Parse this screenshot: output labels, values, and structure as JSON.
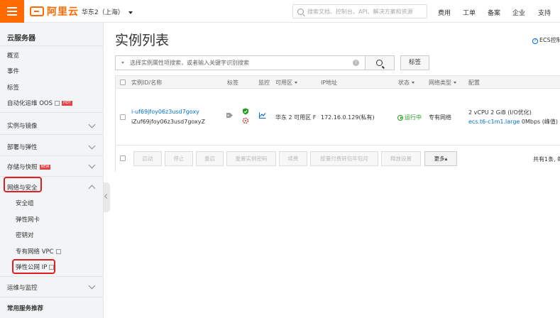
{
  "header": {
    "logo_text": "阿里云",
    "region": "华东2（上海）",
    "search_placeholder": "搜索文档、控制台、API、解决方案和资源",
    "nav": [
      "费用",
      "工单",
      "备案",
      "企业",
      "支持"
    ],
    "brand_color": "#ff6a00"
  },
  "sidebar": {
    "title": "云服务器",
    "items": [
      {
        "label": "概览"
      },
      {
        "label": "事件"
      },
      {
        "label": "标签"
      },
      {
        "label": "自动化运维 OOS",
        "badge": "HOT"
      }
    ],
    "groups": [
      {
        "label": "实例与镜像"
      },
      {
        "label": "部署与弹性"
      },
      {
        "label": "存储与快照",
        "badge": "NEW"
      },
      {
        "label": "网络与安全",
        "expanded": true
      },
      {
        "label": "运维与监控"
      },
      {
        "label": "常用服务推荐"
      }
    ],
    "network_sub": [
      {
        "label": "安全组"
      },
      {
        "label": "弹性网卡"
      },
      {
        "label": "密钥对"
      },
      {
        "label": "专有网络 VPC"
      },
      {
        "label": "弹性公网 IP"
      }
    ]
  },
  "main": {
    "title": "实例列表",
    "ecs_link": "ECS控制",
    "search_placeholder": "选择实例属性项搜索，或者输入关键字识别搜索",
    "tag_button": "标签",
    "columns": {
      "id": "实例ID/名称",
      "tag": "标签",
      "monitor": "监控",
      "zone": "可用区",
      "ip": "IP地址",
      "status": "状态",
      "network": "网络类型",
      "config": "配置"
    },
    "instance": {
      "id": "i-uf69jfoy06z3usd7goxy",
      "name": "iZuf69jfoy06z3usd7goxyZ",
      "zone": "华东 2 可用区 F",
      "ip": "172.16.0.129(私有)",
      "status": "运行中",
      "network": "专有网络",
      "config_line1": "2 vCPU 2 GiB (I/O优化)",
      "instance_type": "ecs.t6-c1m1.large",
      "bandwidth": "0Mbps (峰值)"
    },
    "actions": [
      "启动",
      "停止",
      "重启",
      "重置实例密码",
      "续费",
      "按量付费转包年包月",
      "释放设置",
      "更多▴"
    ],
    "total": "共有1条, 每"
  }
}
